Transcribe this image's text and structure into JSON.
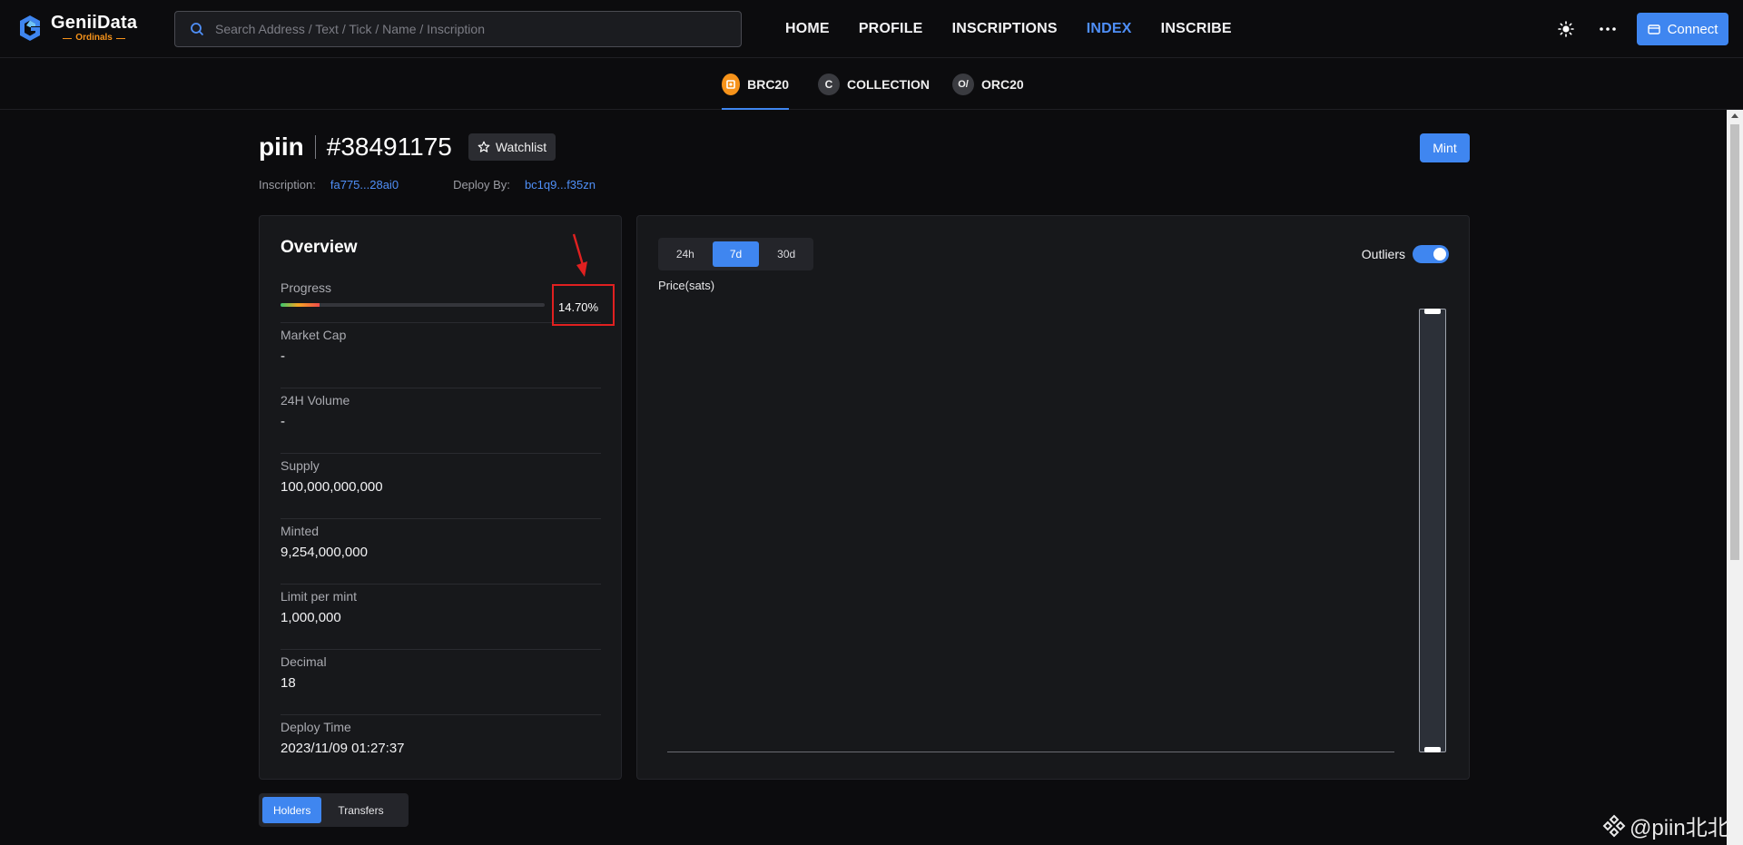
{
  "brand": {
    "name": "GeniiData",
    "sub": "Ordinals",
    "accent": "#3f86f0",
    "orange": "#f7931a"
  },
  "search": {
    "placeholder": "Search Address / Text / Tick / Name / Inscription",
    "icon": "search-icon"
  },
  "nav": {
    "home": "HOME",
    "profile": "PROFILE",
    "inscriptions": "INSCRIPTIONS",
    "index": "INDEX",
    "inscribe": "INSCRIBE"
  },
  "top_right": {
    "theme_icon": "sun-icon",
    "more_icon": "more-icon",
    "connect_label": "Connect"
  },
  "subtabs": {
    "brc20": {
      "label": "BRC20",
      "icon": "bitcoin-icon"
    },
    "collection": {
      "label": "COLLECTION",
      "icon_letter": "C"
    },
    "orc20": {
      "label": "ORC20",
      "icon_text": "O/"
    }
  },
  "token": {
    "tick": "piin",
    "number": "#38491175",
    "watchlist_label": "Watchlist",
    "mint_label": "Mint",
    "inscription_label": "Inscription:",
    "inscription_value": "fa775...28ai0",
    "deploy_label": "Deploy By:",
    "deploy_value": "bc1q9...f35zn"
  },
  "overview": {
    "title": "Overview",
    "progress_label": "Progress",
    "progress_value": "14.70%",
    "progress_fraction": 0.147,
    "market_cap_label": "Market Cap",
    "market_cap_value": "-",
    "volume_label": "24H Volume",
    "volume_value": "-",
    "supply_label": "Supply",
    "supply_value": "100,000,000,000",
    "minted_label": "Minted",
    "minted_value": "9,254,000,000",
    "limit_label": "Limit per mint",
    "limit_value": "1,000,000",
    "decimal_label": "Decimal",
    "decimal_value": "18",
    "deploy_time_label": "Deploy Time",
    "deploy_time_value": "2023/11/09 01:27:37"
  },
  "chart": {
    "ranges": [
      "24h",
      "7d",
      "30d"
    ],
    "active_range": "7d",
    "outliers_label": "Outliers",
    "outliers_on": true,
    "y_label": "Price(sats)"
  },
  "bottom_tabs": {
    "holders": "Holders",
    "transfers": "Transfers"
  },
  "watermark": "@piin北北"
}
